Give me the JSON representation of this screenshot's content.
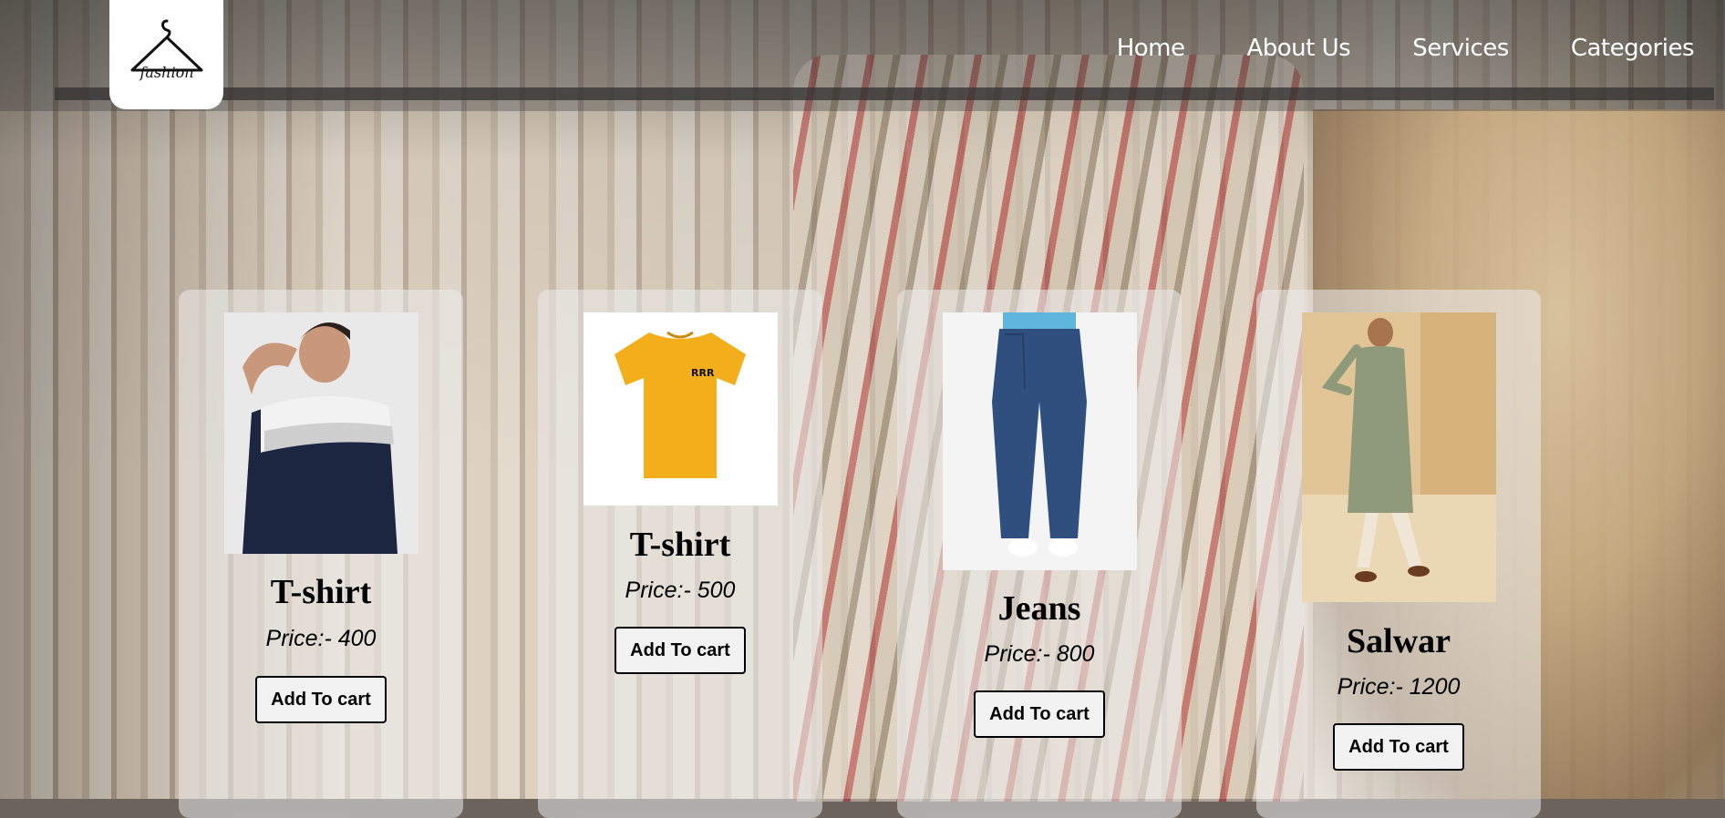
{
  "nav": {
    "items": [
      {
        "label": "Home"
      },
      {
        "label": "About Us"
      },
      {
        "label": "Services"
      },
      {
        "label": "Categories"
      }
    ]
  },
  "logo": {
    "text": "fashion"
  },
  "products": [
    {
      "title": "T-shirt",
      "price": "Price:- 400",
      "button": "Add To cart",
      "image": "man-navy-white-tshirt"
    },
    {
      "title": "T-shirt",
      "price": "Price:- 500",
      "button": "Add To cart",
      "image": "yellow-tshirt"
    },
    {
      "title": "Jeans",
      "price": "Price:- 800",
      "button": "Add To cart",
      "image": "blue-jeans"
    },
    {
      "title": "Salwar",
      "price": "Price:- 1200",
      "button": "Add To cart",
      "image": "man-salwar"
    }
  ],
  "colors": {
    "nav_text": "#ffffff",
    "card_bg": "rgba(235,235,235,0.55)",
    "button_border": "#000000"
  }
}
